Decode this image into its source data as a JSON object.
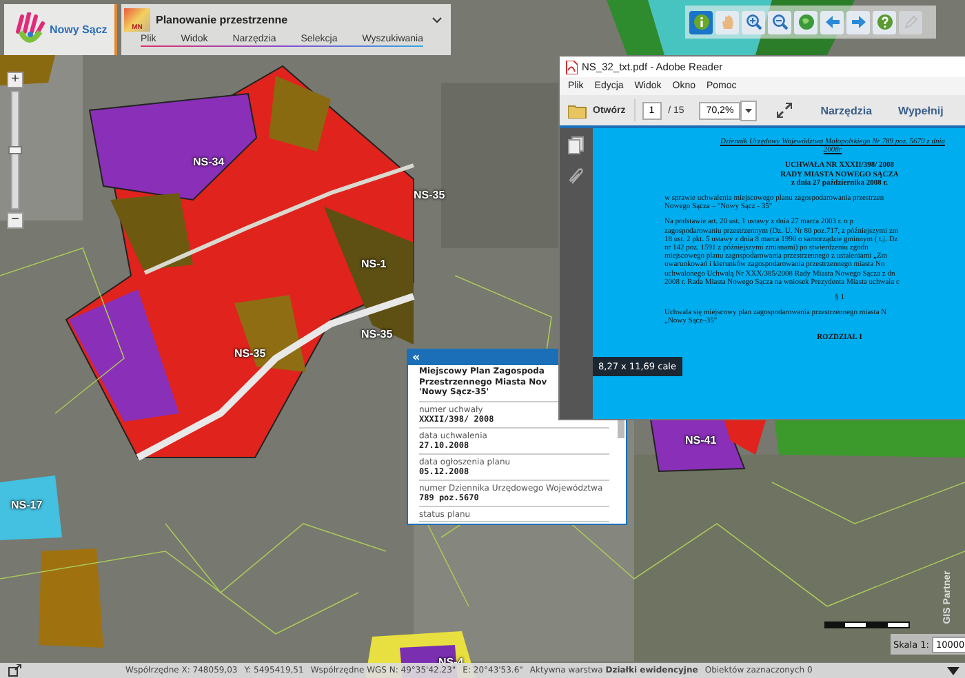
{
  "header": {
    "logo_text": "Nowy Sącz",
    "app_badge": "MN",
    "app_title": "Planowanie przestrzenne",
    "menu": [
      "Plik",
      "Widok",
      "Narzędzia",
      "Selekcja",
      "Wyszukiwania"
    ]
  },
  "toolbar": [
    {
      "kind": "info",
      "selected": true,
      "disabled": false
    },
    {
      "kind": "hand",
      "selected": false,
      "disabled": false
    },
    {
      "kind": "zoom-in",
      "selected": false,
      "disabled": false
    },
    {
      "kind": "zoom-out",
      "selected": false,
      "disabled": false
    },
    {
      "kind": "globe",
      "selected": false,
      "disabled": false
    },
    {
      "kind": "back",
      "selected": false,
      "disabled": false
    },
    {
      "kind": "forward",
      "selected": false,
      "disabled": false
    },
    {
      "kind": "help",
      "selected": false,
      "disabled": false
    },
    {
      "kind": "edit",
      "selected": false,
      "disabled": true
    }
  ],
  "map": {
    "zoom_in": "+",
    "zoom_out": "−",
    "zoom_level": {
      "level": 0.5
    },
    "labels": [
      "NS-34",
      "NS-35",
      "NS-1",
      "NS-35",
      "NS-35",
      "NS-17",
      "NS-41",
      "NS-4"
    ],
    "brand": "GIS Partner",
    "scale_label": "Skala 1:",
    "scale_value": "10000"
  },
  "pdf": {
    "title": "NS_32_txt.pdf - Adobe Reader",
    "menu": [
      "Plik",
      "Edycja",
      "Widok",
      "Okno",
      "Pomoc"
    ],
    "open_button": "Otwórz",
    "page": "1",
    "page_count": "/ 15",
    "zoom": "70,2%",
    "tools_button": "Narzędzia",
    "fill_button": "Wypełnij",
    "page_size": "8,27 x 11,69 cale",
    "blocks": [
      {
        "kind": "journal",
        "lines": [
          "Dziennik Urzędowy Województwa Małopolskiego Nr 789 poz. 5670 z dnia",
          "2008r"
        ]
      },
      {
        "kind": "heading",
        "lines": [
          "UCHWAŁA NR XXXII/398/ 2008",
          "RADY MIASTA NOWEGO SĄCZA",
          "z dnia 27 października 2008 r."
        ]
      },
      {
        "kind": "paragraph",
        "lines": [
          "w sprawie uchwalenia miejscowego planu zagospodarowania przestrzen",
          "Nowego Sącza – \"Nowy Sącz - 35\""
        ]
      },
      {
        "kind": "paragraph",
        "lines": [
          "Na podstawie art. 20 ust. 1 ustawy z dnia 27 marca 2003 r. o p",
          "zagospodarowaniu przestrzennym (Dz. U. Nr 80 poz.717, z późniejszymi zm",
          "18 ust. 2 pkt. 5 ustawy z dnia 8 marca 1990 o samorządzie gminnym ( t.j. Dz",
          "nr 142 poz. 1591 z późniejszymi zmianami) po stwierdzeniu zgodn",
          "miejscowego planu zagospodarowania przestrzennego z ustaleniami „Zm",
          "uwarunkowań i kierunków zagospodarowania przestrzennego miasta No",
          "uchwalonego Uchwałą Nr XXX/385/2008 Rady Miasta Nowego Sącza z dn",
          "2008 r. Rada Miasta Nowego Sącza na wniosek Prezydenta Miasta uchwala c"
        ]
      },
      {
        "kind": "center",
        "lines": [
          "§ 1"
        ]
      },
      {
        "kind": "paragraph",
        "lines": [
          "Uchwala się miejscowy plan zagospodarowania przestrzennego miasta N",
          "„Nowy Sącz–35\""
        ]
      },
      {
        "kind": "heading",
        "lines": [
          "ROZDZIAŁ I"
        ]
      }
    ]
  },
  "popup": {
    "collapse": "«",
    "title_lines": [
      "Miejscowy Plan Zagospoda",
      "Przestrzennego Miasta Nov",
      "'Nowy Sącz-35'"
    ],
    "fields": [
      {
        "label": "numer uchwały",
        "value": "XXXII/398/ 2008"
      },
      {
        "label": "data uchwalenia",
        "value": "27.10.2008"
      },
      {
        "label": "data ogłoszenia planu",
        "value": "05.12.2008"
      },
      {
        "label": "numer Dziennika Urzędowego Województwa",
        "value": "789 poz.5670"
      },
      {
        "label": "status planu"
      }
    ]
  },
  "status_bar": [
    "Współrzędne X: 748059,03",
    "Y: 5495419,51",
    "Współrzędne WGS N: 49°35'42.23\"",
    "E: 20°43'53.6\"",
    "Aktywna warstwa **Działki ewidencyjne**",
    "Obiektów zaznaczonych 0"
  ]
}
